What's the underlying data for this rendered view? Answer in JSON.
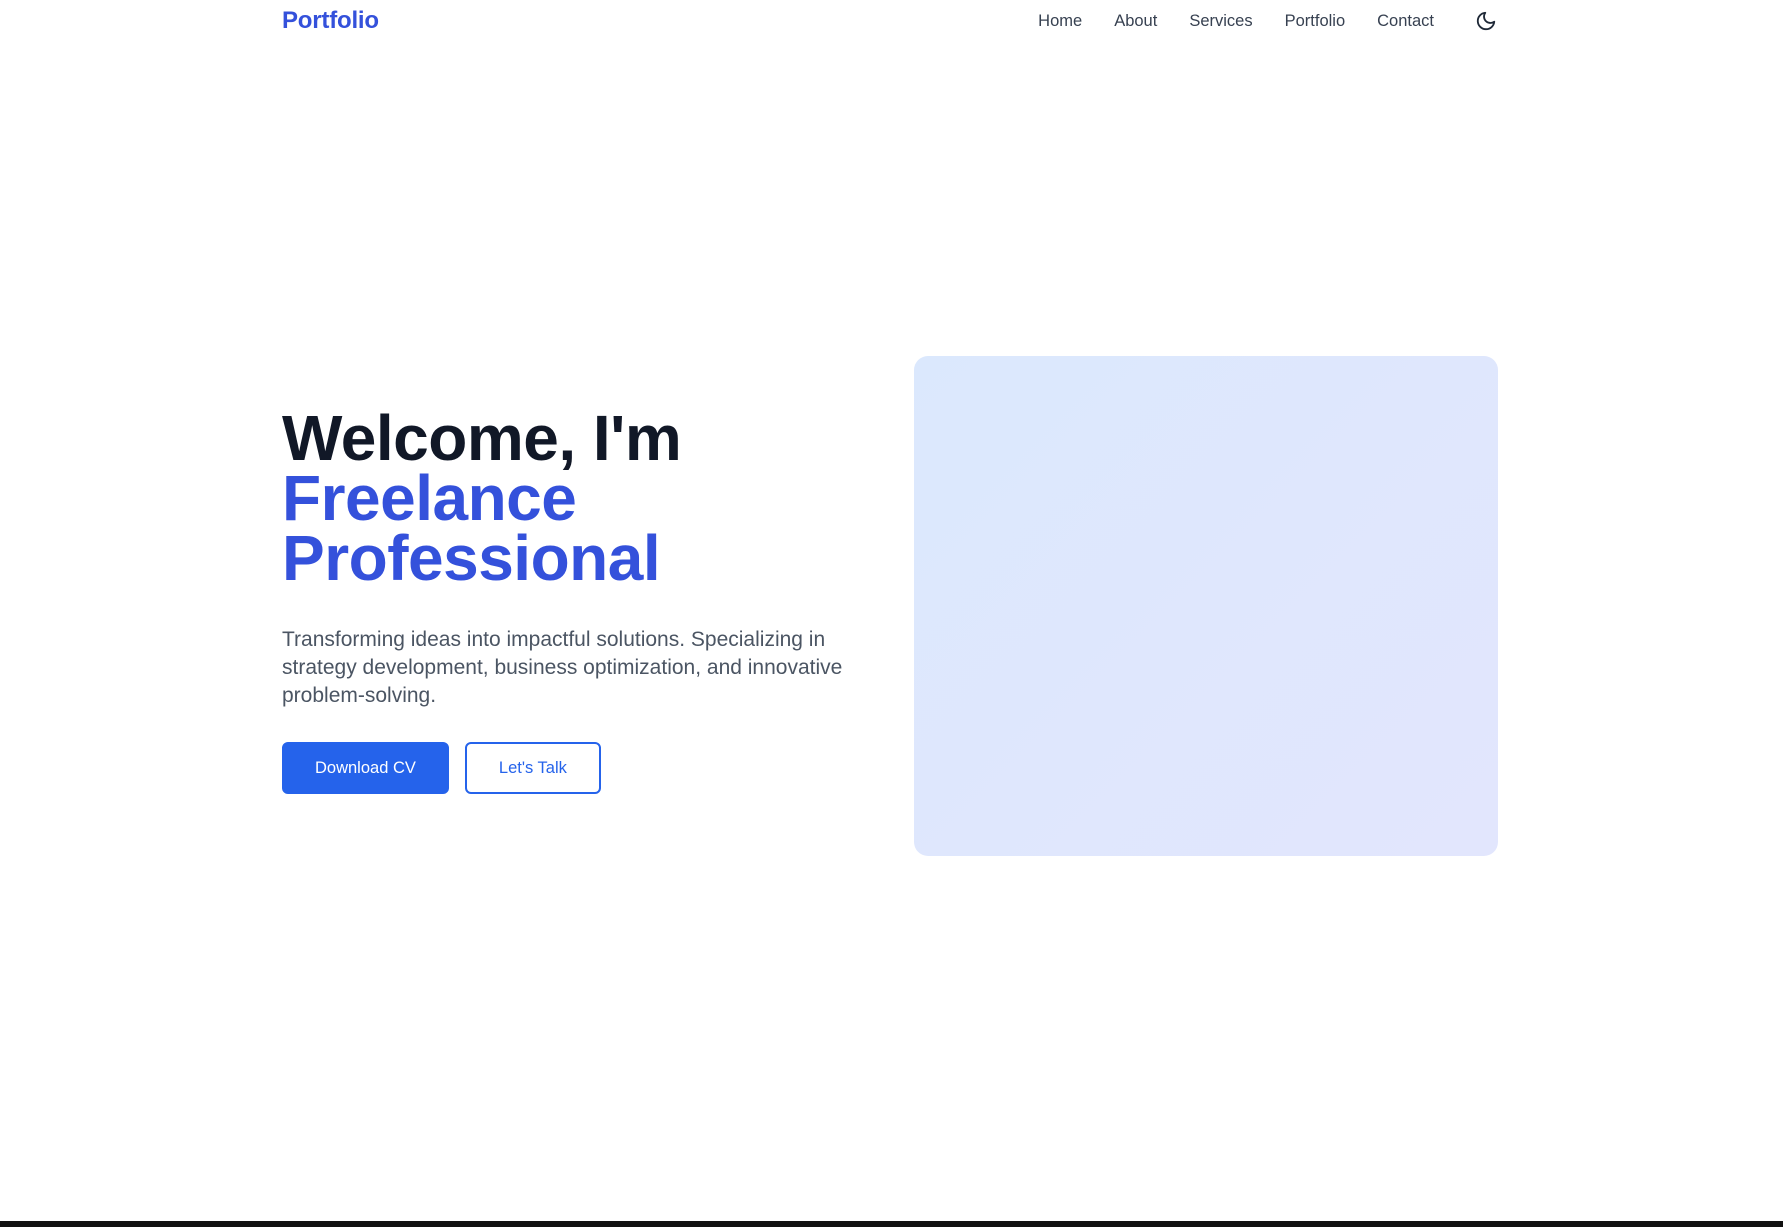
{
  "header": {
    "logo": "Portfolio",
    "nav": {
      "home": "Home",
      "about": "About",
      "services": "Services",
      "portfolio": "Portfolio",
      "contact": "Contact"
    },
    "theme_toggle_icon": "moon-icon"
  },
  "hero": {
    "title_line1": "Welcome, I'm",
    "title_accent_line1": "Freelance",
    "title_accent_line2": "Professional",
    "description": "Transforming ideas into impactful solutions. Specializing in strategy development, business optimization, and innovative problem-solving.",
    "primary_button": "Download CV",
    "secondary_button": "Let's Talk"
  },
  "colors": {
    "accent": "#3451db",
    "button_blue": "#2563eb",
    "heading": "#111827",
    "body_text": "#4b5563",
    "image_placeholder": "#dde7fd"
  }
}
